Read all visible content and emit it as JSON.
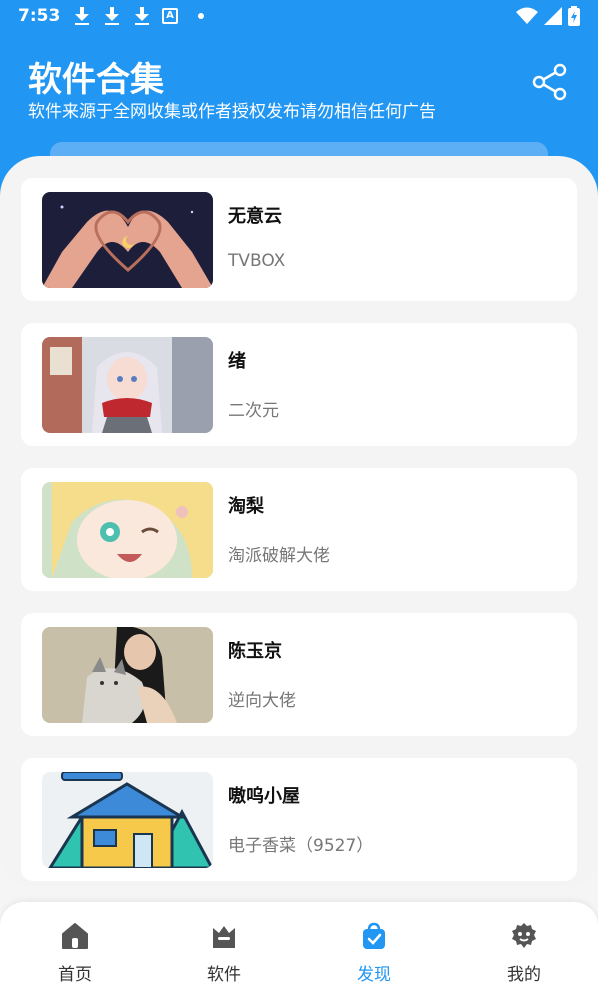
{
  "status_bar": {
    "time": "7:53",
    "icons_left": [
      "download-icon",
      "download-icon",
      "download-icon",
      "a-icon",
      "dot-icon"
    ],
    "icons_right": [
      "wifi-icon",
      "signal-icon",
      "battery-icon"
    ]
  },
  "header": {
    "title": "软件合集",
    "subtitle": "软件来源于全网收集或作者授权发布请勿相信任何广告",
    "share_icon": "share-icon",
    "background_color": "#2196f3"
  },
  "cards": [
    {
      "title": "无意云",
      "desc": "TVBOX",
      "thumb_icon": "heart-hands-image"
    },
    {
      "title": "绪",
      "desc": "二次元",
      "thumb_icon": "anime-girl-snow-image"
    },
    {
      "title": "淘梨",
      "desc": "淘派破解大佬",
      "thumb_icon": "anime-girl-wink-image"
    },
    {
      "title": "陈玉京",
      "desc": "逆向大佬",
      "thumb_icon": "girl-with-cat-image"
    },
    {
      "title": "嗷呜小屋",
      "desc": "电子香菜（9527）",
      "thumb_icon": "cabin-image"
    }
  ],
  "nav": {
    "items": [
      {
        "label": "首页",
        "icon": "home-icon",
        "active": false
      },
      {
        "label": "软件",
        "icon": "crown-bag-icon",
        "active": false
      },
      {
        "label": "发现",
        "icon": "discover-bag-icon",
        "active": true
      },
      {
        "label": "我的",
        "icon": "profile-icon",
        "active": false
      }
    ],
    "active_color": "#2196f3"
  }
}
